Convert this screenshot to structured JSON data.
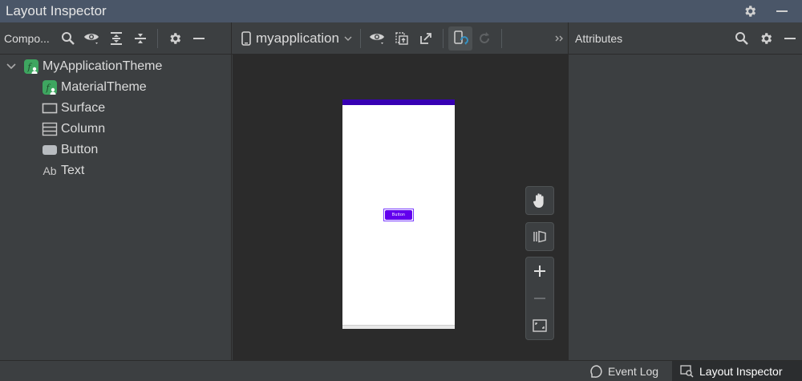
{
  "window": {
    "title": "Layout Inspector"
  },
  "tree_panel": {
    "label": "Compo...",
    "items": [
      {
        "label": "MyApplicationTheme",
        "icon": "compose-function-icon",
        "expanded": true
      },
      {
        "label": "MaterialTheme",
        "icon": "compose-function-icon"
      },
      {
        "label": "Surface",
        "icon": "surface-icon"
      },
      {
        "label": "Column",
        "icon": "column-icon"
      },
      {
        "label": "Button",
        "icon": "button-icon"
      },
      {
        "label": "Text",
        "icon": "text-icon",
        "icon_text": "Ab"
      }
    ]
  },
  "view_toolbar": {
    "process": "myapplication"
  },
  "device_preview": {
    "button_label": "Button"
  },
  "attributes_panel": {
    "label": "Attributes"
  },
  "status_bar": {
    "event_log": "Event Log",
    "layout_inspector": "Layout Inspector"
  },
  "colors": {
    "title_bar": "#4a5668",
    "panel_bg": "#3c3f41",
    "canvas_bg": "#2b2b2b",
    "compose_icon": "#3ea660",
    "device_status_bar": "#3700b3",
    "device_button": "#6200ee",
    "active_blue": "#3592c4"
  }
}
